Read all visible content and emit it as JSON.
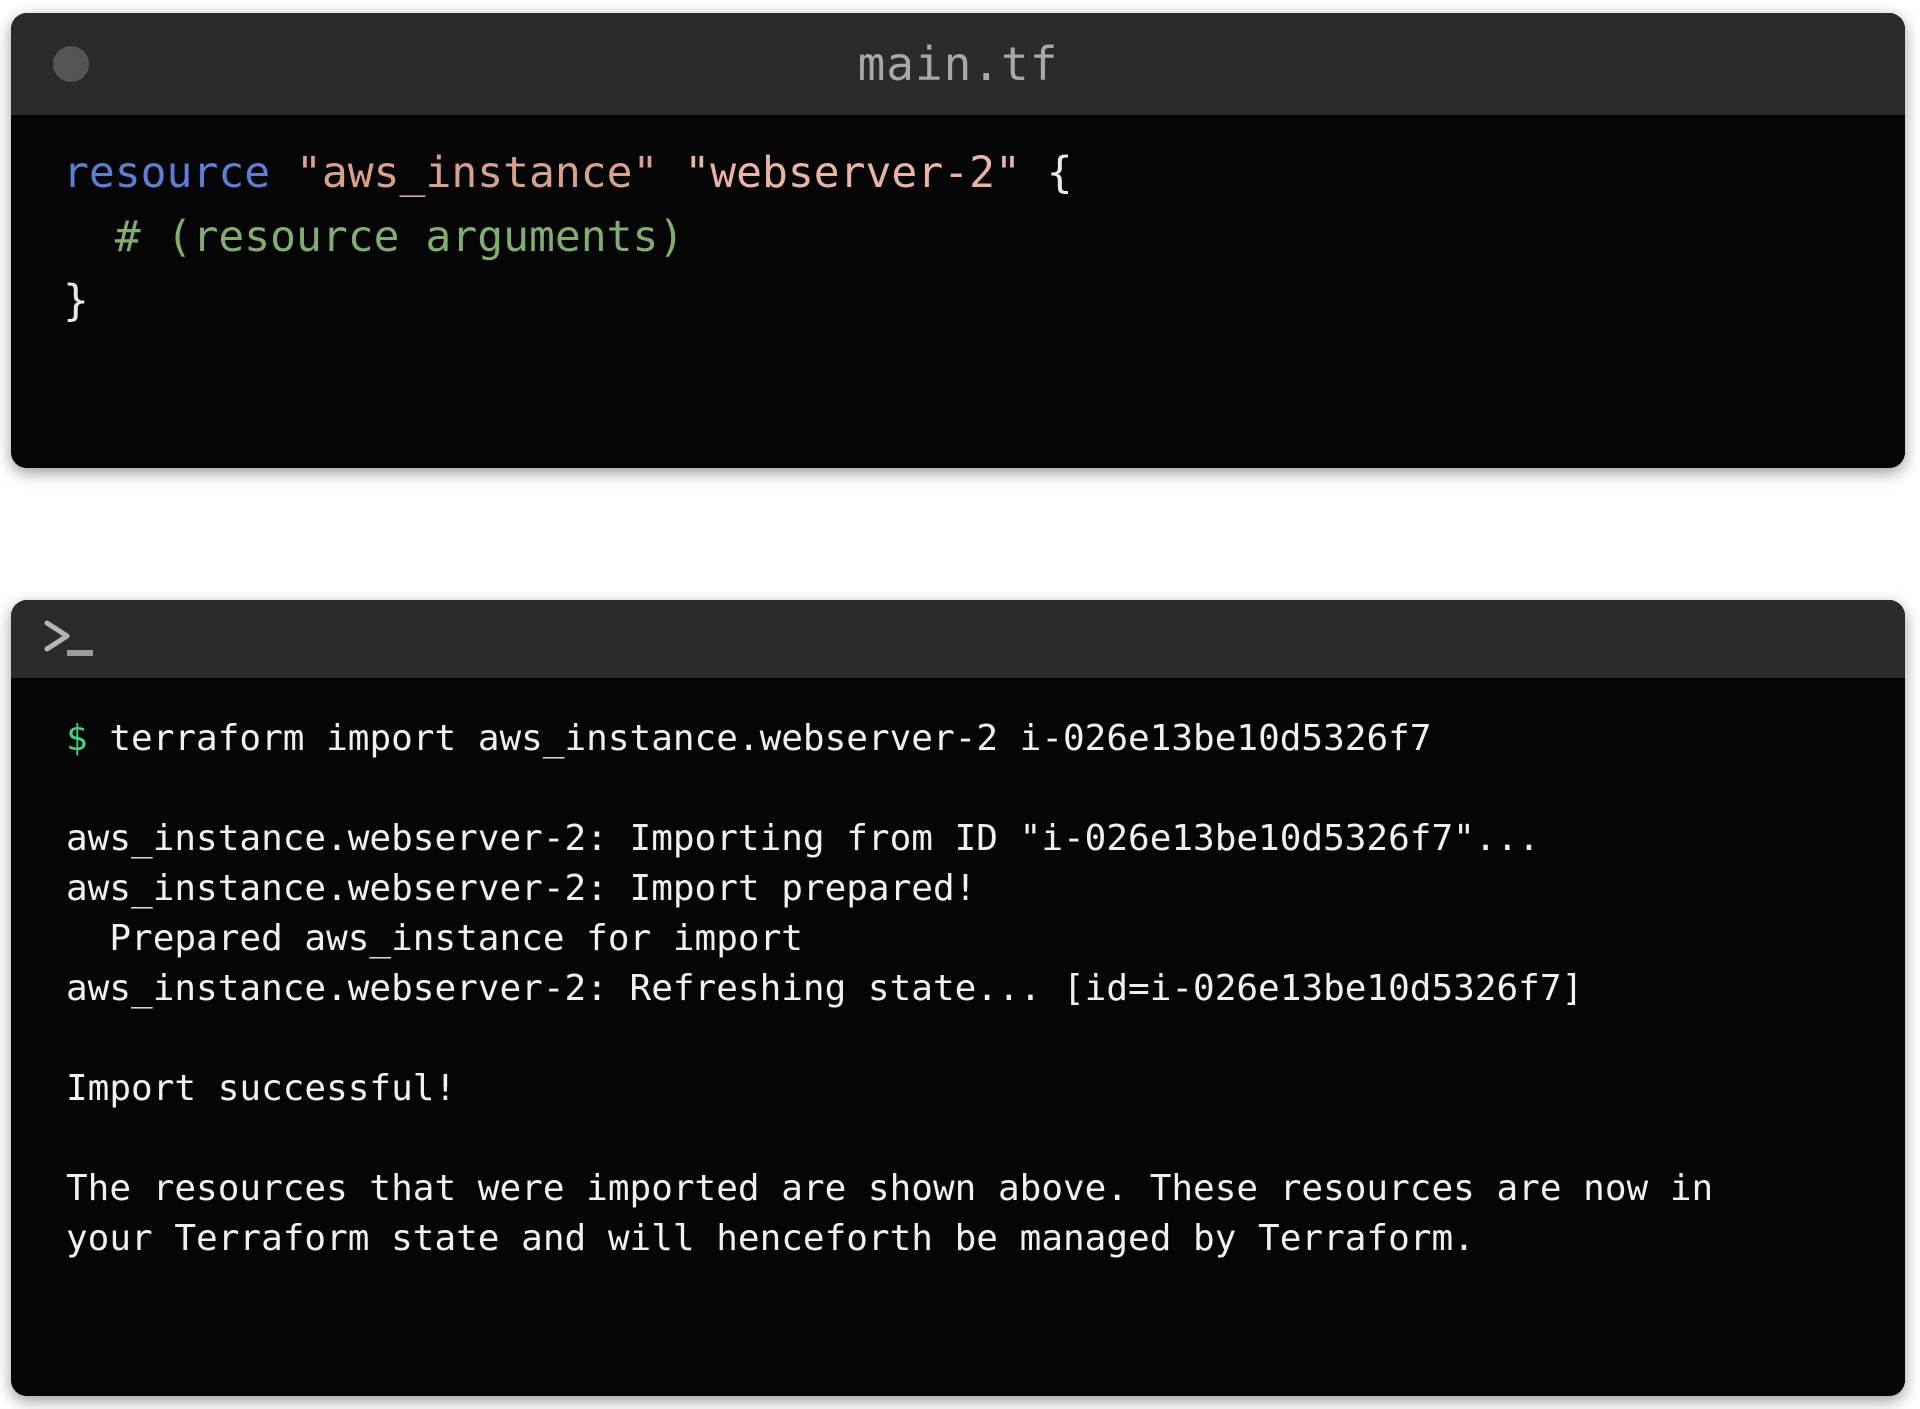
{
  "editor": {
    "window_dot": "window-control-dot",
    "title": "main.tf",
    "code": {
      "line1": {
        "keyword": "resource",
        "space1": " ",
        "string1": "\"aws_instance\"",
        "space2": " ",
        "string2": "\"webserver-2\"",
        "space3": " ",
        "brace_open": "{"
      },
      "line2": "  # (resource arguments)",
      "line3": "}"
    }
  },
  "terminal": {
    "prompt_glyph": ">_",
    "command": {
      "prompt": "$",
      "text": " terraform import aws_instance.webserver-2 i-026e13be10d5326f7"
    },
    "output_lines": [
      "",
      "aws_instance.webserver-2: Importing from ID \"i-026e13be10d5326f7\"...",
      "aws_instance.webserver-2: Import prepared!",
      "  Prepared aws_instance for import",
      "aws_instance.webserver-2: Refreshing state... [id=i-026e13be10d5326f7]",
      "",
      "Import successful!",
      "",
      "The resources that were imported are shown above. These resources are now in",
      "your Terraform state and will henceforth be managed by Terraform."
    ]
  },
  "colors": {
    "panel_background": "#050505",
    "titlebar_background": "#2b2b2b",
    "title_text": "#a8a8a8",
    "keyword": "#5b7fd4",
    "string_primary": "#d8a28a",
    "string_secondary": "#e9b4a4",
    "comment": "#7fae6e",
    "terminal_text": "#f0f0f0",
    "prompt_dollar": "#3fd47c",
    "page_background": "#ffffff"
  }
}
